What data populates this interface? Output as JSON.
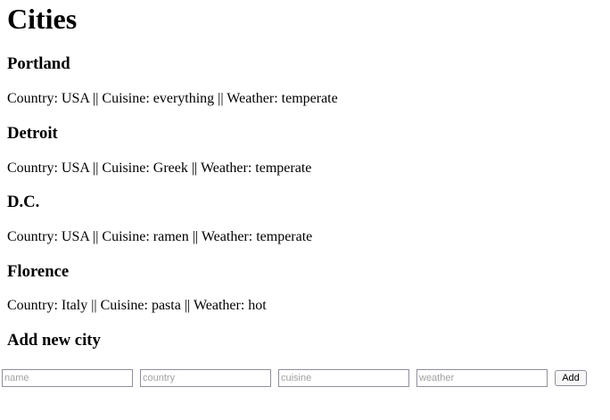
{
  "page": {
    "title": "Cities"
  },
  "cities": [
    {
      "name": "Portland",
      "details": "Country: USA || Cuisine: everything || Weather: temperate"
    },
    {
      "name": "Detroit",
      "details": "Country: USA || Cuisine: Greek || Weather: temperate"
    },
    {
      "name": "D.C.",
      "details": "Country: USA || Cuisine: ramen || Weather: temperate"
    },
    {
      "name": "Florence",
      "details": "Country: Italy || Cuisine: pasta || Weather: hot"
    }
  ],
  "add_form": {
    "heading": "Add new city",
    "name_placeholder": "name",
    "country_placeholder": "country",
    "cuisine_placeholder": "cuisine",
    "weather_placeholder": "weather",
    "name_value": "",
    "country_value": "",
    "cuisine_value": "",
    "weather_value": "",
    "submit_label": "Add"
  }
}
